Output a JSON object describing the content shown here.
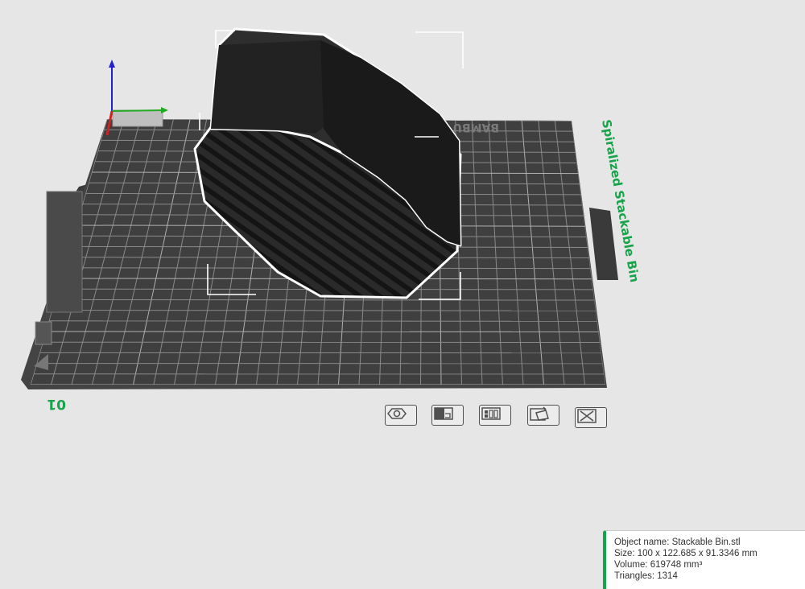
{
  "plate": {
    "name": "Spiralized Stackable Bin",
    "number": "01",
    "brand_text": "BAMBU SMOOTH",
    "colors": {
      "accent": "#16a34a",
      "plate": "#3f3f3f",
      "grid": "#8a8a8a",
      "background": "#e6e6e6",
      "model": "#262626"
    }
  },
  "plate_toolbar": {
    "buttons": [
      {
        "icon": "orient-icon"
      },
      {
        "icon": "arrange-icon"
      },
      {
        "icon": "auto-layout-icon"
      },
      {
        "icon": "plate-settings-icon"
      },
      {
        "icon": "delete-plate-icon"
      }
    ]
  },
  "object_info": {
    "name_line": "Object name: Stackable Bin.stl",
    "size_line": "Size: 100 x 122.685 x 91.3346 mm",
    "volume_line": "Volume: 619748 mm³",
    "triangles_line": "Triangles: 1314"
  }
}
